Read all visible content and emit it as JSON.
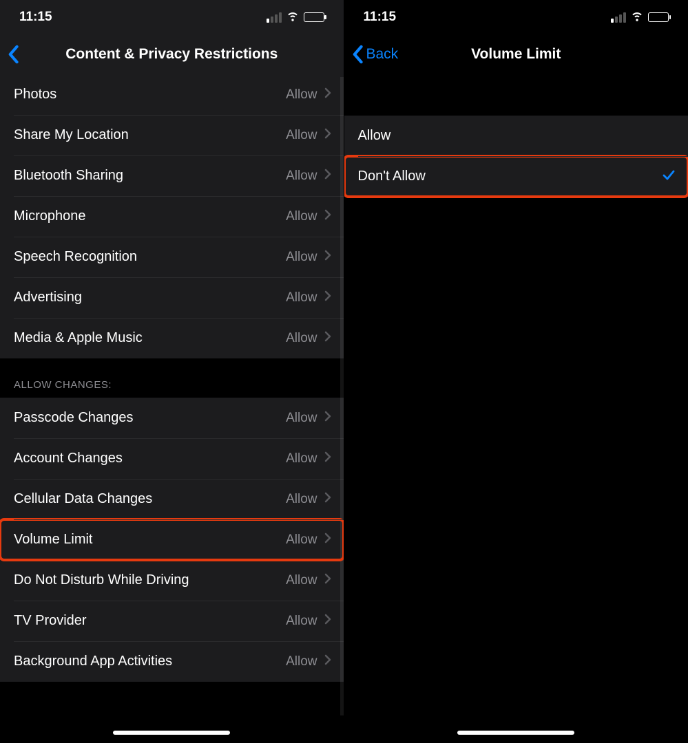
{
  "status": {
    "time": "11:15"
  },
  "left": {
    "title": "Content & Privacy Restrictions",
    "section1": {
      "items": [
        {
          "label": "Photos",
          "value": "Allow"
        },
        {
          "label": "Share My Location",
          "value": "Allow"
        },
        {
          "label": "Bluetooth Sharing",
          "value": "Allow"
        },
        {
          "label": "Microphone",
          "value": "Allow"
        },
        {
          "label": "Speech Recognition",
          "value": "Allow"
        },
        {
          "label": "Advertising",
          "value": "Allow"
        },
        {
          "label": "Media & Apple Music",
          "value": "Allow"
        }
      ]
    },
    "section2_header": "Allow Changes:",
    "section2": {
      "items": [
        {
          "label": "Passcode Changes",
          "value": "Allow"
        },
        {
          "label": "Account Changes",
          "value": "Allow"
        },
        {
          "label": "Cellular Data Changes",
          "value": "Allow"
        },
        {
          "label": "Volume Limit",
          "value": "Allow"
        },
        {
          "label": "Do Not Disturb While Driving",
          "value": "Allow"
        },
        {
          "label": "TV Provider",
          "value": "Allow"
        },
        {
          "label": "Background App Activities",
          "value": "Allow"
        }
      ]
    }
  },
  "right": {
    "back_label": "Back",
    "title": "Volume Limit",
    "options": [
      {
        "label": "Allow",
        "selected": false
      },
      {
        "label": "Don't Allow",
        "selected": true
      }
    ]
  }
}
